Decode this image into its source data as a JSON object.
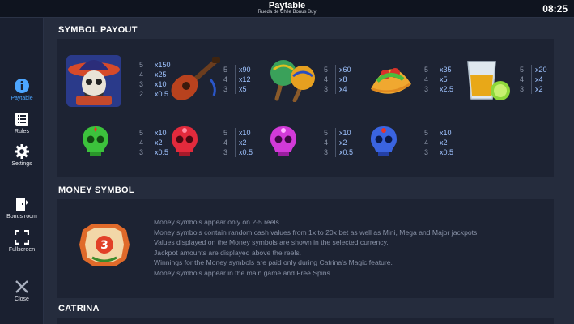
{
  "header": {
    "title": "Paytable",
    "subtitle": "Rueda de Chile Bonus Buy",
    "clock": "08:25"
  },
  "sidebar": {
    "items": [
      {
        "label": "Paytable",
        "icon": "info-icon",
        "active": true
      },
      {
        "label": "Rules",
        "icon": "list-icon",
        "active": false
      },
      {
        "label": "Settings",
        "icon": "gear-icon",
        "active": false
      },
      {
        "label": "Bonus room",
        "icon": "bonus-room-icon",
        "active": false
      },
      {
        "label": "Fullscreen",
        "icon": "fullscreen-icon",
        "active": false
      },
      {
        "label": "Close",
        "icon": "close-icon",
        "active": false
      }
    ]
  },
  "sections": {
    "symbol_payout": "SYMBOL PAYOUT",
    "money_symbol": "MONEY SYMBOL",
    "catrina": "CATRINA"
  },
  "symbols": [
    {
      "name": "skull-mariachi",
      "pays": [
        [
          "5",
          "x150"
        ],
        [
          "4",
          "x25"
        ],
        [
          "3",
          "x10"
        ],
        [
          "2",
          "x0.5"
        ]
      ]
    },
    {
      "name": "guitar",
      "pays": [
        [
          "5",
          "x90"
        ],
        [
          "4",
          "x12"
        ],
        [
          "3",
          "x5"
        ]
      ]
    },
    {
      "name": "maracas",
      "pays": [
        [
          "5",
          "x60"
        ],
        [
          "4",
          "x8"
        ],
        [
          "3",
          "x4"
        ]
      ]
    },
    {
      "name": "taco",
      "pays": [
        [
          "5",
          "x35"
        ],
        [
          "4",
          "x5"
        ],
        [
          "3",
          "x2.5"
        ]
      ]
    },
    {
      "name": "tequila",
      "pays": [
        [
          "5",
          "x20"
        ],
        [
          "4",
          "x4"
        ],
        [
          "3",
          "x2"
        ]
      ]
    },
    {
      "name": "green-skull",
      "pays": [
        [
          "5",
          "x10"
        ],
        [
          "4",
          "x2"
        ],
        [
          "3",
          "x0.5"
        ]
      ]
    },
    {
      "name": "red-skull",
      "pays": [
        [
          "5",
          "x10"
        ],
        [
          "4",
          "x2"
        ],
        [
          "3",
          "x0.5"
        ]
      ]
    },
    {
      "name": "purple-skull",
      "pays": [
        [
          "5",
          "x10"
        ],
        [
          "4",
          "x2"
        ],
        [
          "3",
          "x0.5"
        ]
      ]
    },
    {
      "name": "blue-skull",
      "pays": [
        [
          "5",
          "x10"
        ],
        [
          "4",
          "x2"
        ],
        [
          "3",
          "x0.5"
        ]
      ]
    }
  ],
  "money": {
    "symbol_value": "3",
    "lines": [
      "Money symbols appear only on 2-5 reels.",
      "Money symbols contain random cash values from 1x to 20x bet as well as Mini, Mega and Major jackpots.",
      "Values displayed on the Money symbols are shown in the selected currency.",
      "Jackpot amounts are displayed above the reels.",
      "Winnings for the Money symbols are paid only during Catrina's Magic feature.",
      "Money symbols appear in the main game and Free Spins."
    ]
  },
  "colors": {
    "accent": "#4da6ff",
    "multiplier": "#9fc3ff",
    "background": "#252c3d",
    "panel": "#1d2333"
  }
}
